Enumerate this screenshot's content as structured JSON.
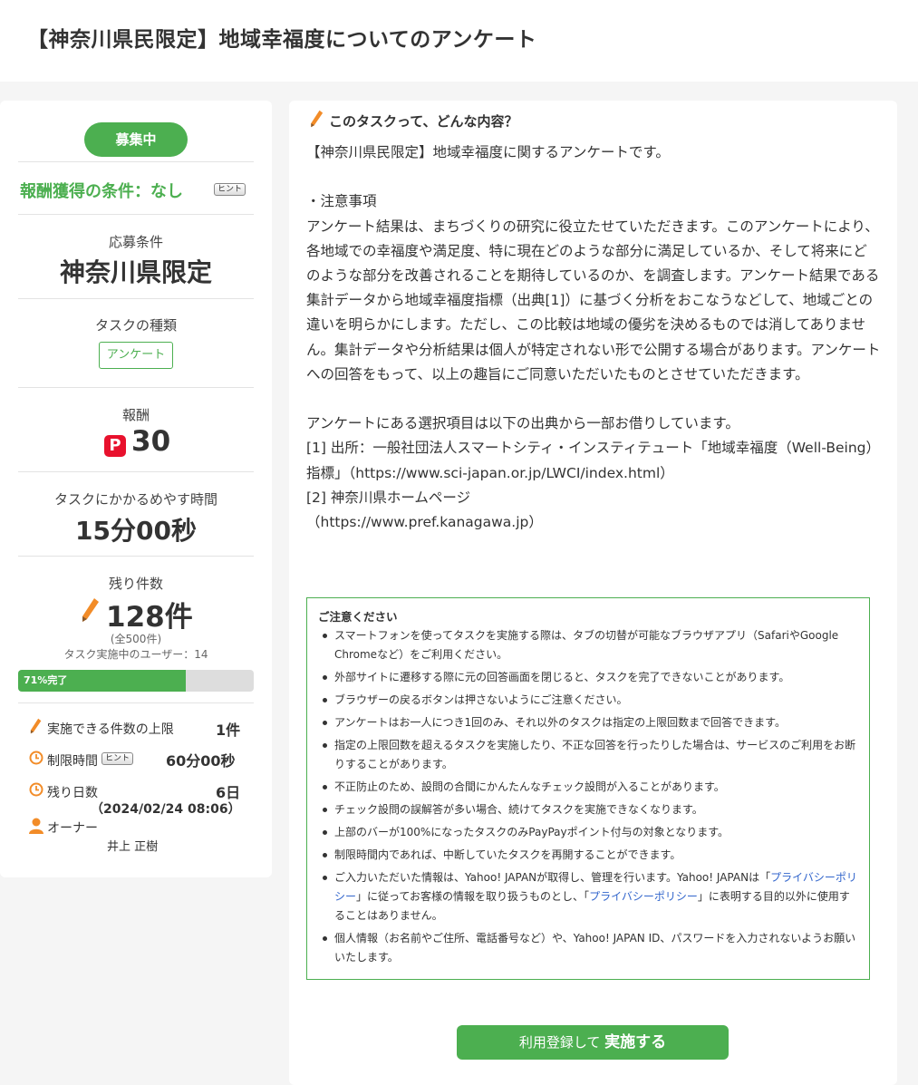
{
  "page": {
    "title": "【神奈川県民限定】地域幸福度についてのアンケート"
  },
  "sidebar": {
    "status": "募集中",
    "reward_condition": "報酬獲得の条件：なし",
    "hint_label": "ヒント",
    "eligibility_label": "応募条件",
    "eligibility_value": "神奈川県限定",
    "task_type_label": "タスクの種類",
    "task_type_value": "アンケート",
    "reward_label": "報酬",
    "reward_icon_letter": "P",
    "reward_value": "30",
    "time_label": "タスクにかかるめやす時間",
    "time_value": "15分00秒",
    "remaining_label": "残り件数",
    "remaining_value": "128件",
    "remaining_total": "(全500件)",
    "active_users": "タスク実施中のユーザー：14",
    "progress_text": "71%完了",
    "progress_fraction": 0.71,
    "limit_label": "実施できる件数の上限",
    "limit_value": "1件",
    "timelimit_label": "制限時間",
    "timelimit_value": "60分00秒",
    "days_label": "残り日数",
    "days_value": "6日",
    "deadline": "（2024/02/24 08:06）",
    "owner_label": "オーナー",
    "owner_value": "井上 正樹"
  },
  "main": {
    "section_title": "このタスクって、どんな内容？",
    "description": [
      "【神奈川県民限定】地域幸福度に関するアンケートです。",
      "",
      "・注意事項",
      "アンケート結果は、まちづくりの研究に役立たせていただきます。このアンケートにより、各地域での幸福度や満足度、特に現在どのような部分に満足しているか、そして将来にどのような部分を改善されることを期待しているのか、を調査します。アンケート結果である集計データから地域幸福度指標（出典[1]）に基づく分析をおこなうなどして、地域ごとの違いを明らかにします。ただし、この比較は地域の優劣を決めるものでは消してありません。集計データや分析結果は個人が特定されない形で公開する場合があります。アンケートへの回答をもって、以上の趣旨にご同意いただいたものとさせていただきます。",
      "",
      "アンケートにある選択項目は以下の出典から一部お借りしています。",
      "[1] 出所：一般社団法人スマートシティ・インスティテュート「地域幸福度（Well-Being）指標」（https://www.sci-japan.or.jp/LWCI/index.html）",
      "[2] 神奈川県ホームページ",
      "（https://www.pref.kanagawa.jp）"
    ],
    "notice_title": "ご注意ください",
    "notices": [
      "スマートフォンを使ってタスクを実施する際は、タブの切替が可能なブラウザアプリ（SafariやGoogle Chromeなど）をご利用ください。",
      "外部サイトに遷移する際に元の回答画面を閉じると、タスクを完了できないことがあります。",
      "ブラウザーの戻るボタンは押さないようにご注意ください。",
      "アンケートはお一人につき1回のみ、それ以外のタスクは指定の上限回数まで回答できます。",
      "指定の上限回数を超えるタスクを実施したり、不正な回答を行ったりした場合は、サービスのご利用をお断りすることがあります。",
      "不正防止のため、設問の合間にかんたんなチェック設問が入ることがあります。",
      "チェック設問の誤解答が多い場合、続けてタスクを実施できなくなります。",
      "上部のバーが100%になったタスクのみPayPayポイント付与の対象となります。",
      "制限時間内であれば、中断していたタスクを再開することができます。"
    ],
    "privacy_notice": {
      "part1": "ご入力いただいた情報は、Yahoo! JAPANが取得し、管理を行います。Yahoo! JAPANは「",
      "link1": "プライバシーポリシー",
      "part2": "」に従ってお客様の情報を取り扱うものとし、「",
      "link2": "プライバシーポリシー",
      "part3": "」に表明する目的以外に使用することはありません。"
    },
    "last_notice": "個人情報（お名前やご住所、電話番号など）や、Yahoo! JAPAN ID、パスワードを入力されないようお願いいたします。",
    "cta_prefix": "利用登録して",
    "cta_main": "実施する"
  },
  "colors": {
    "accent": "#4caf50",
    "paypay": "#e8112d",
    "link": "#3366cc"
  }
}
